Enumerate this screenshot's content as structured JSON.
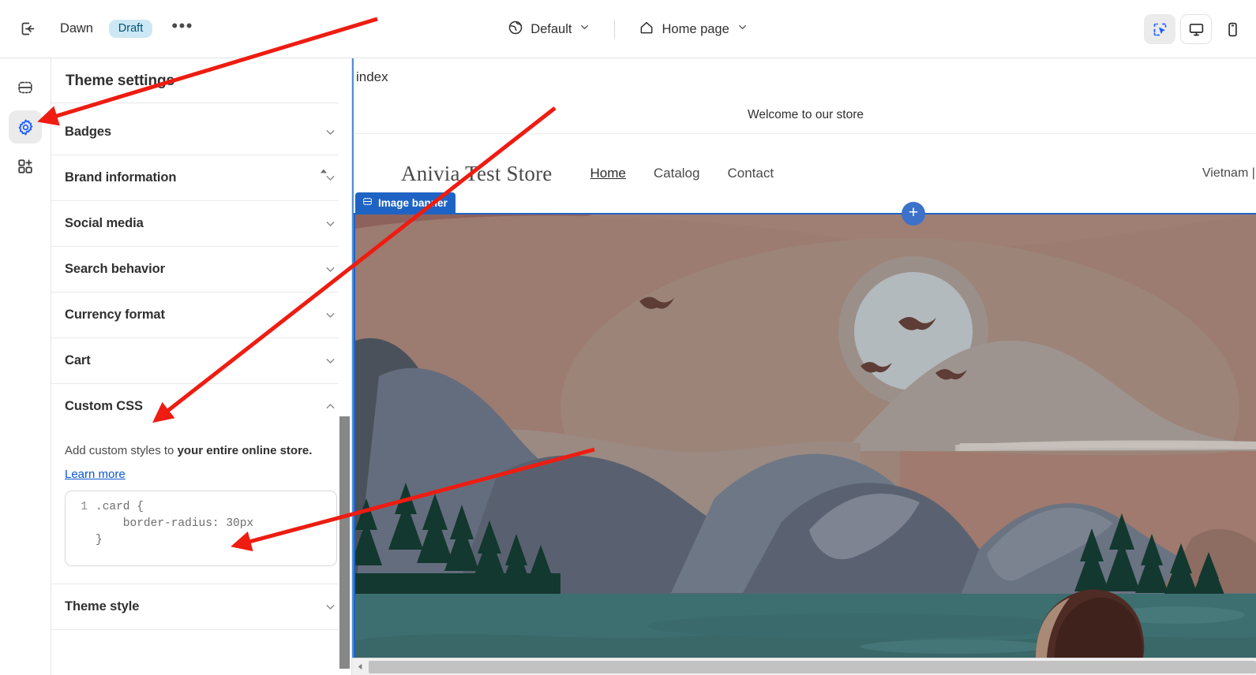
{
  "topbar": {
    "exit_icon": "exit-door-icon",
    "theme_name": "Dawn",
    "status_badge": "Draft",
    "more_label": "•••",
    "market": {
      "icon": "globe-icon",
      "label": "Default",
      "chevron": "chevron-down-icon"
    },
    "page": {
      "icon": "home-icon",
      "label": "Home page",
      "chevron": "chevron-down-icon"
    },
    "devices": [
      {
        "name": "inspector-toggle",
        "icon": "dashed-cursor-icon",
        "active": true
      },
      {
        "name": "desktop-view",
        "icon": "desktop-monitor-icon",
        "active": true
      },
      {
        "name": "mobile-view",
        "icon": "mobile-phone-icon",
        "active": false
      }
    ]
  },
  "rail": {
    "items": [
      {
        "name": "sections",
        "icon": "sections-icon",
        "active": false
      },
      {
        "name": "theme-settings",
        "icon": "gear-icon",
        "active": true
      },
      {
        "name": "apps",
        "icon": "apps-add-icon",
        "active": false
      }
    ]
  },
  "panel": {
    "title": "Theme settings",
    "accordions": [
      {
        "label": "Badges",
        "state": "collapsed"
      },
      {
        "label": "Brand information",
        "state": "collapsed"
      },
      {
        "label": "Social media",
        "state": "collapsed"
      },
      {
        "label": "Search behavior",
        "state": "collapsed"
      },
      {
        "label": "Currency format",
        "state": "collapsed"
      },
      {
        "label": "Cart",
        "state": "collapsed"
      }
    ],
    "custom_css": {
      "label": "Custom CSS",
      "state": "expanded",
      "description_prefix": "Add custom styles to ",
      "description_bold": "your entire online store.",
      "learn_more": "Learn more",
      "editor": {
        "line_number": "1",
        "lines": [
          ".card {",
          "    border-radius: 30px",
          "}"
        ]
      }
    },
    "last_accordion": {
      "label": "Theme style",
      "state": "collapsed"
    }
  },
  "preview": {
    "template_label": "index",
    "announcement": "Welcome to our store",
    "logo": "Anivia Test Store",
    "nav": [
      {
        "label": "Home",
        "current": true
      },
      {
        "label": "Catalog",
        "current": false
      },
      {
        "label": "Contact",
        "current": false
      }
    ],
    "locale": "Vietnam | V",
    "section_tag": {
      "icon": "image-banner-icon",
      "label": "Image banner"
    },
    "add_section_label": "+"
  },
  "colors": {
    "accent_blue": "#1f64c4",
    "rail_active_blue": "#1f5eff",
    "badge_bg": "#cde8f5",
    "badge_text": "#00527c",
    "annotation_red": "#ee1c11",
    "link_blue": "#0b57d0"
  }
}
